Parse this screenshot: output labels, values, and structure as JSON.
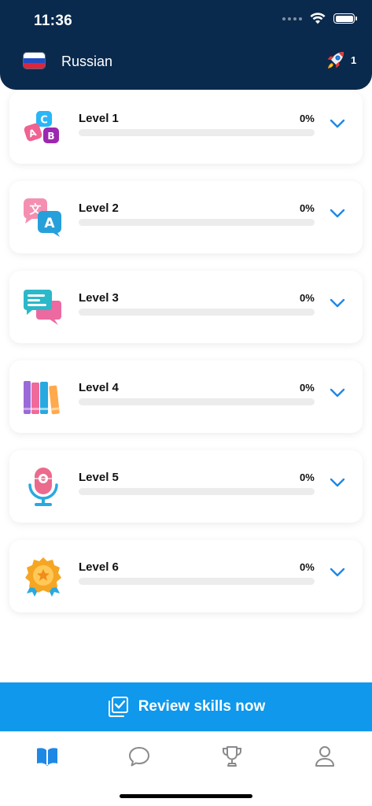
{
  "status_bar": {
    "time": "11:36"
  },
  "header": {
    "language": "Russian",
    "flag_colors": [
      "#ffffff",
      "#1f4fc4",
      "#e0243a"
    ],
    "streak_icon": "rocket-icon",
    "streak_count": "1"
  },
  "levels": [
    {
      "title": "Level 1",
      "percent": "0%",
      "progress": 0,
      "icon": "abc-blocks-icon"
    },
    {
      "title": "Level 2",
      "percent": "0%",
      "progress": 0,
      "icon": "translate-icon"
    },
    {
      "title": "Level 3",
      "percent": "0%",
      "progress": 0,
      "icon": "chat-bubbles-icon"
    },
    {
      "title": "Level 4",
      "percent": "0%",
      "progress": 0,
      "icon": "books-icon"
    },
    {
      "title": "Level 5",
      "percent": "0%",
      "progress": 0,
      "icon": "microphone-icon"
    },
    {
      "title": "Level 6",
      "percent": "0%",
      "progress": 0,
      "icon": "medal-icon"
    }
  ],
  "review_button": {
    "label": "Review skills now",
    "icon": "checklist-icon"
  },
  "tab_bar": {
    "tabs": [
      {
        "name": "learn",
        "icon": "book-icon",
        "active": true
      },
      {
        "name": "chat",
        "icon": "speech-bubble-icon",
        "active": false
      },
      {
        "name": "achievements",
        "icon": "trophy-icon",
        "active": false
      },
      {
        "name": "profile",
        "icon": "person-icon",
        "active": false
      }
    ]
  },
  "colors": {
    "header_bg": "#0a2a4d",
    "accent": "#1e88e5",
    "review_bg": "#0f98ec",
    "inactive_tab": "#8a8a8e"
  }
}
